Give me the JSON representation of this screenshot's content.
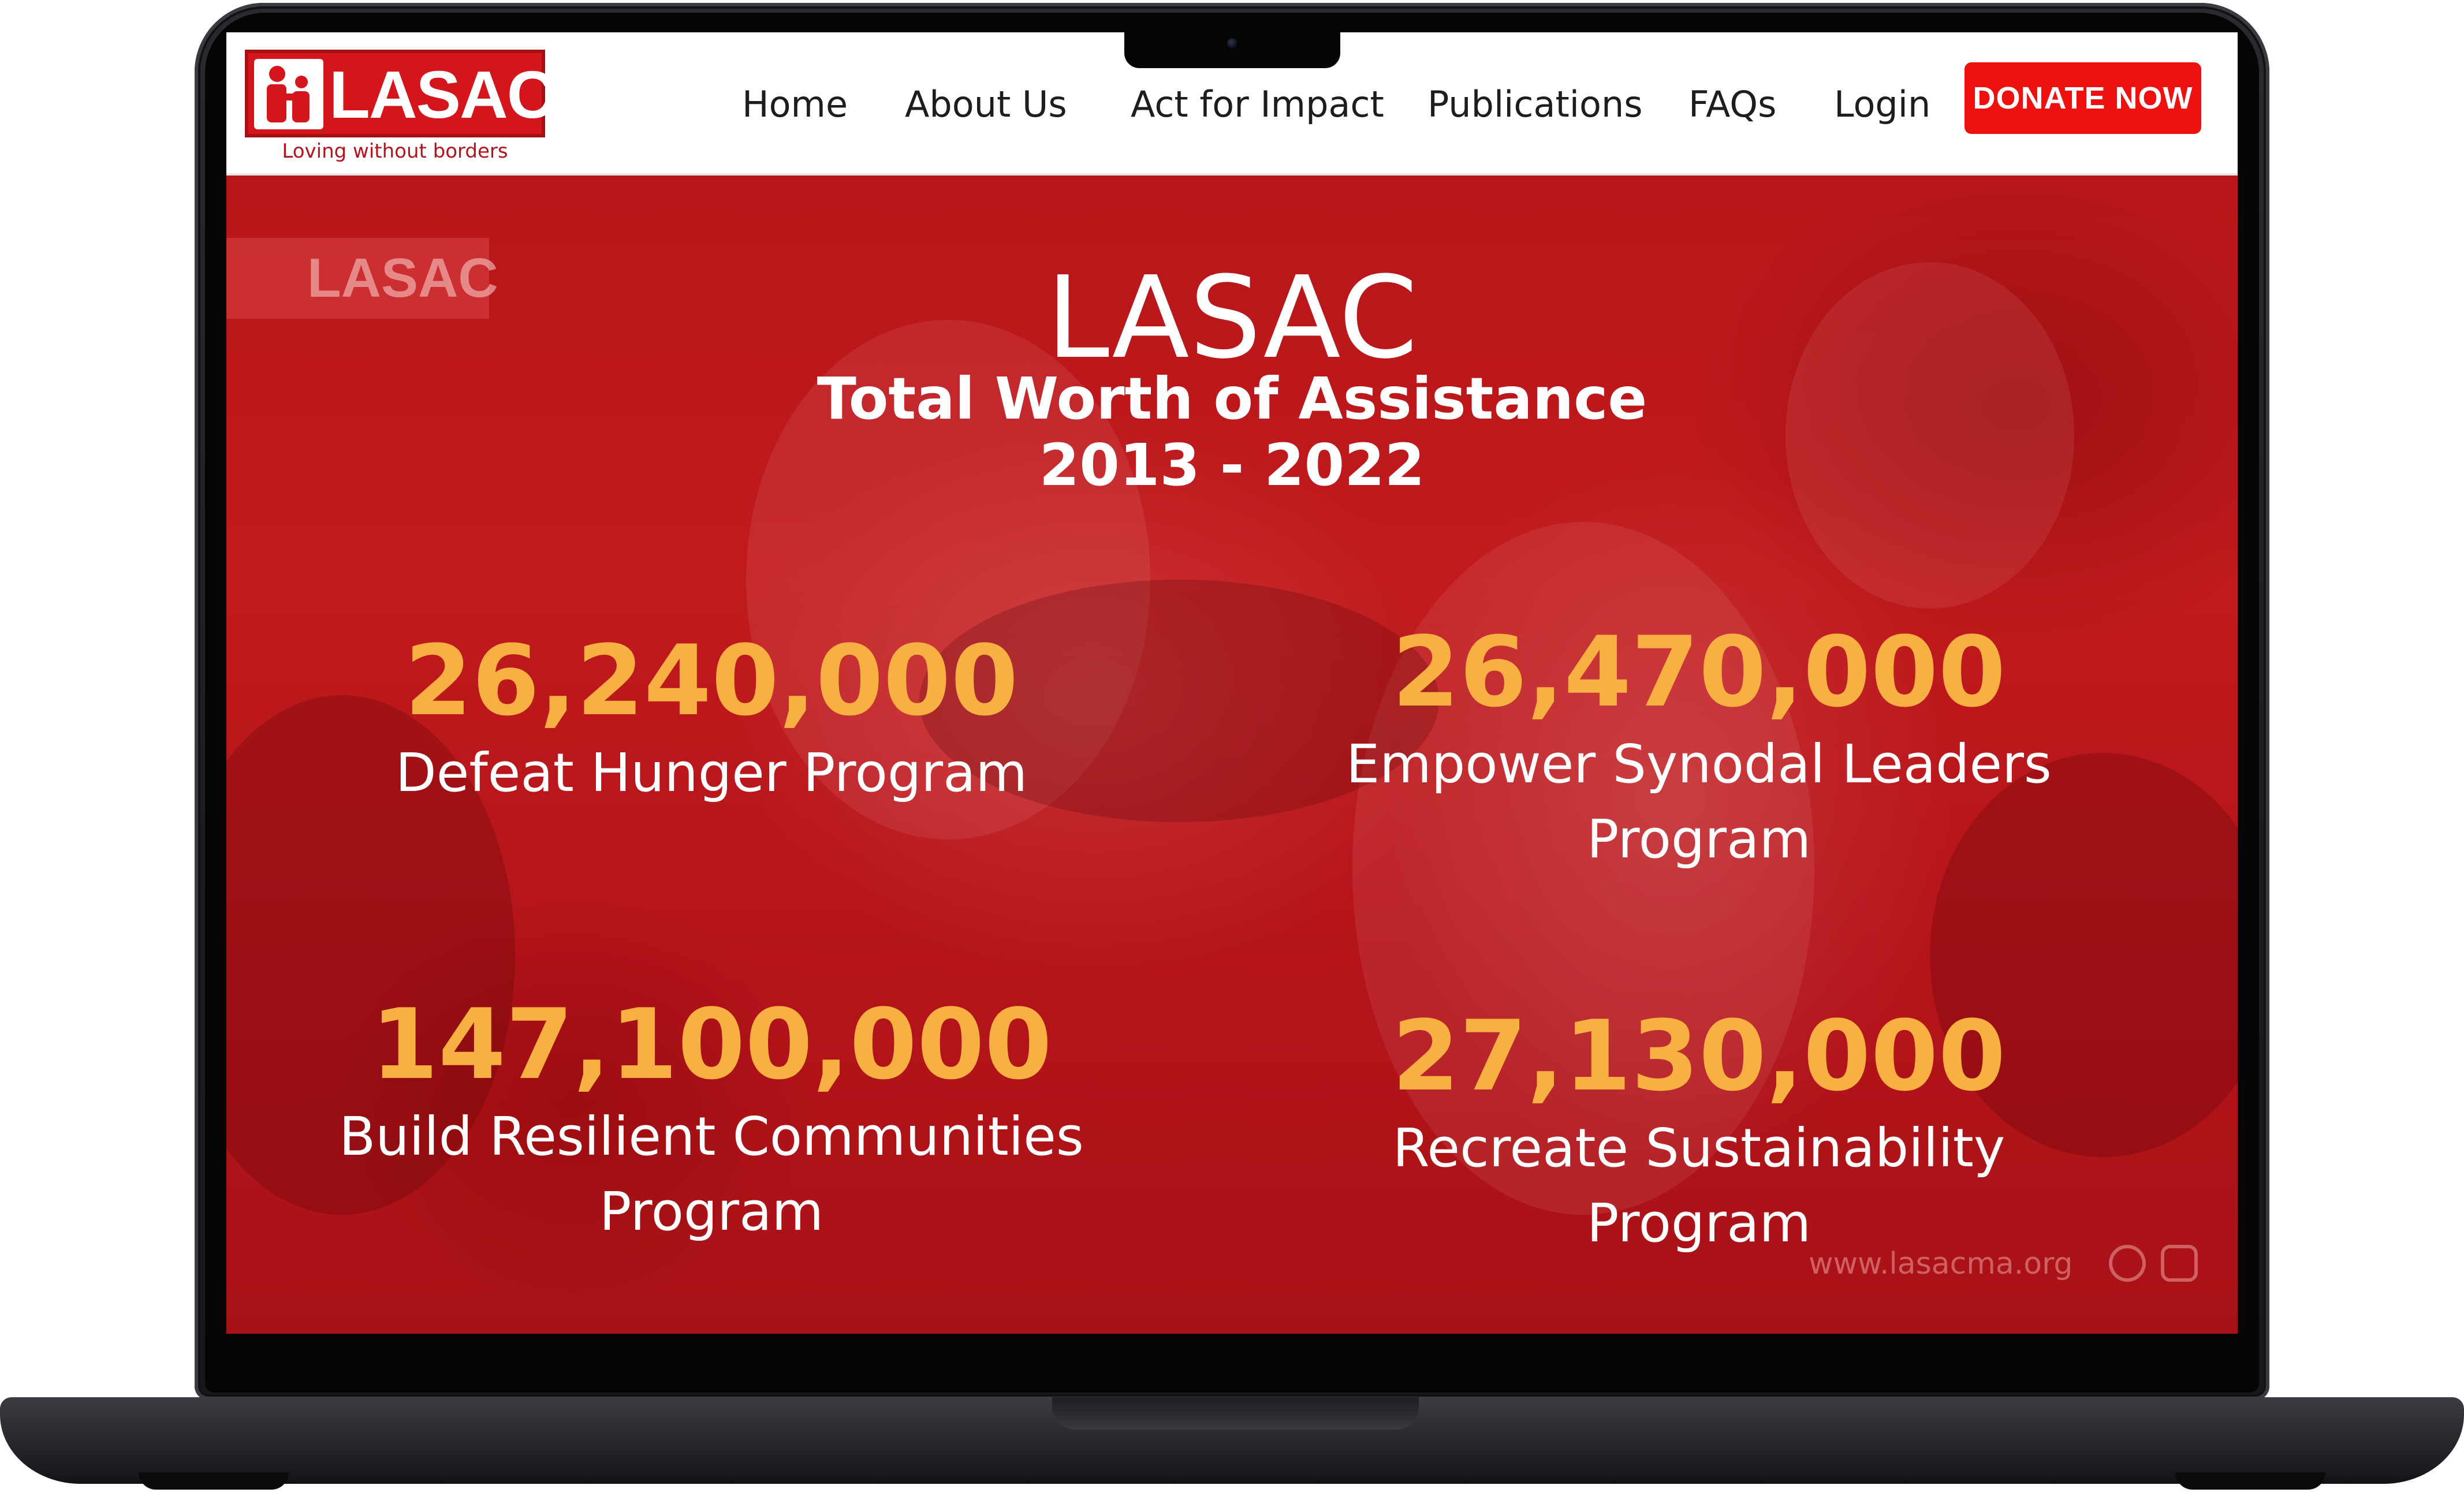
{
  "brand": {
    "logo_text": "LASAC",
    "tagline": "Loving without borders",
    "primary_color": "#d4161c",
    "accent_color": "#f9b042"
  },
  "nav": {
    "items": [
      {
        "label": "Home"
      },
      {
        "label": "About Us"
      },
      {
        "label": "Act for Impact"
      },
      {
        "label": "Publications"
      },
      {
        "label": "FAQs"
      },
      {
        "label": "Login"
      }
    ],
    "donate_label": "DONATE NOW"
  },
  "hero": {
    "watermark_logo": "LASAC",
    "title": "LASAC",
    "subtitle": "Total Worth of Assistance",
    "years": "2013 - 2022",
    "stats": [
      {
        "value": "26,240,000",
        "label": "Defeat Hunger Program"
      },
      {
        "value": "26,470,000",
        "label": "Empower Synodal Leaders Program"
      },
      {
        "value": "147,100,000",
        "label": "Build Resilient Communities Program"
      },
      {
        "value": "27,130,000",
        "label": "Recreate Sustainability Program"
      }
    ],
    "footer_url": "www.lasacma.org",
    "social_icons": [
      "facebook-icon",
      "youtube-icon"
    ]
  }
}
